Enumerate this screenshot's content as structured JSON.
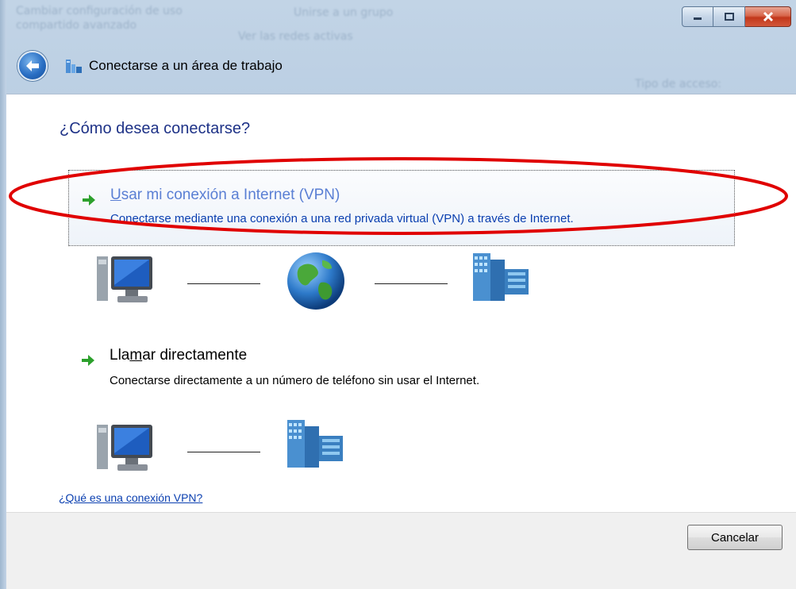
{
  "window": {
    "title": "Conectarse a un área de trabajo",
    "buttons": {
      "minimize_icon": "minimize-icon",
      "maximize_icon": "maximize-icon",
      "close_icon": "close-icon"
    }
  },
  "background_ghost_text": {
    "t1": "Cambiar configuración de uso",
    "t2": "compartido avanzado",
    "t3": "Ver las redes activas",
    "t4": "Tipo de acceso:",
    "t5": "Unirse a un grupo"
  },
  "main": {
    "question": "¿Cómo desea conectarse?",
    "options": [
      {
        "title_pre": "",
        "title_accel": "U",
        "title_post": "sar mi conexión a Internet (VPN)",
        "description": "Conectarse mediante una conexión a una red privada virtual (VPN) a través de Internet.",
        "icon": "green-arrow-icon"
      },
      {
        "title_pre": "Lla",
        "title_accel": "m",
        "title_post": "ar directamente",
        "description": "Conectarse directamente a un número de teléfono sin usar el Internet.",
        "icon": "green-arrow-icon"
      }
    ],
    "help_link": "¿Qué es una conexión VPN?"
  },
  "footer": {
    "cancel_label": "Cancelar"
  },
  "colors": {
    "heading": "#1e3287",
    "option_title_highlight": "#5a7fd4",
    "option_desc_highlight": "#0a3fb0",
    "annotation": "#e00000",
    "arrow_green": "#2ca02c"
  }
}
